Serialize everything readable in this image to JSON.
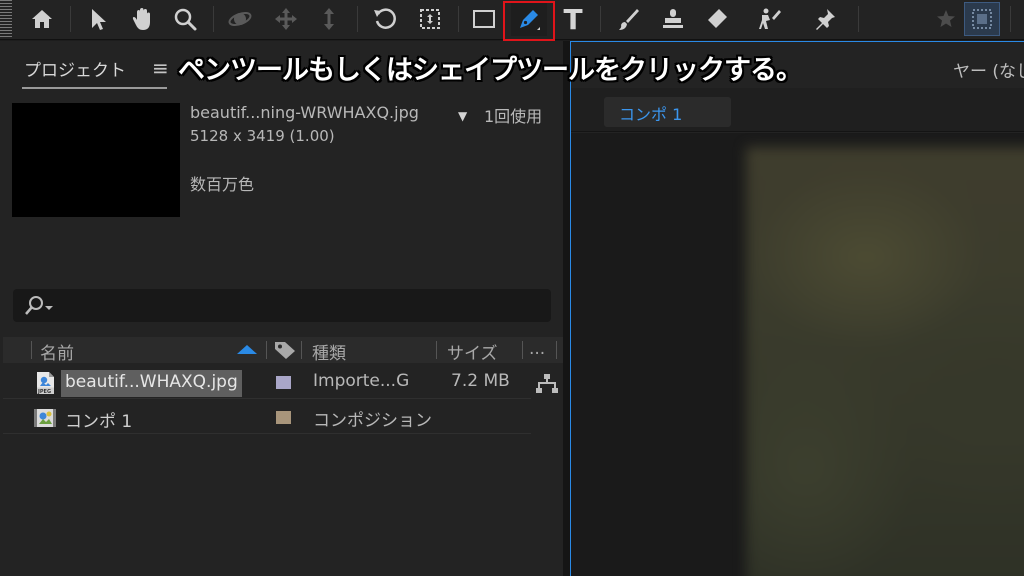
{
  "toolbar": {
    "tools": [
      {
        "icon": "home-icon"
      },
      {
        "icon": "selection-arrow-icon"
      },
      {
        "icon": "hand-icon"
      },
      {
        "icon": "zoom-icon"
      },
      {
        "icon": "orbit-camera-icon"
      },
      {
        "icon": "pan-camera-icon"
      },
      {
        "icon": "dolly-camera-icon"
      },
      {
        "icon": "rotate-icon"
      },
      {
        "icon": "pan-behind-icon"
      },
      {
        "icon": "rectangle-icon"
      },
      {
        "icon": "pen-icon",
        "active": true
      },
      {
        "icon": "type-icon",
        "glyph": "T"
      },
      {
        "icon": "brush-icon"
      },
      {
        "icon": "clone-stamp-icon"
      },
      {
        "icon": "eraser-icon"
      },
      {
        "icon": "roto-brush-icon"
      },
      {
        "icon": "puppet-pin-icon"
      },
      {
        "icon": "star-icon"
      },
      {
        "icon": "snapping-icon"
      }
    ],
    "highlight_color": "#e0141a"
  },
  "project": {
    "tab_label": "プロジェクト",
    "menu_glyph": "≡",
    "footage": {
      "name": "beautif...ning-WRWHAXQ.jpg",
      "dropdown_glyph": "▼",
      "usage": "1回使用",
      "dimensions": "5128 x 3419 (1.00)",
      "colors": "数百万色"
    },
    "columns": {
      "name": "名前",
      "type": "種類",
      "size": "サイズ",
      "more": "..."
    },
    "items": [
      {
        "name": "beautif...WHAXQ.jpg",
        "type": "Importe...G",
        "size": "7.2 MB",
        "label_color": "#a9a6c8",
        "icon": "jpeg-file-icon",
        "icon_text": "JPEG",
        "selected": true
      },
      {
        "name": "コンポ 1",
        "type": "コンポジション",
        "size": "",
        "label_color": "#a8957b",
        "icon": "composition-icon",
        "selected": false
      }
    ]
  },
  "composition": {
    "layer_label": "ヤー (なし)",
    "tab_label": "コンポ 1"
  },
  "caption": "ペンツールもしくはシェイプツールをクリックする。",
  "colors": {
    "accent": "#2a8ae6",
    "panel_bg": "#232323"
  }
}
